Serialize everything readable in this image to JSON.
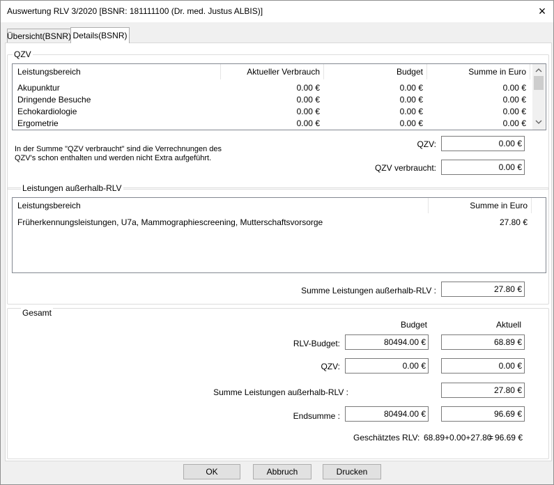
{
  "window": {
    "title": "Auswertung RLV 3/2020 [BSNR: 181111100 (Dr. med. Justus ALBIS)]",
    "close_icon": "×"
  },
  "tabs": [
    {
      "label": "Übersicht(BSNR)"
    },
    {
      "label": "Details(BSNR)"
    }
  ],
  "qzv": {
    "group_label": "QZV",
    "columns": [
      "Leistungsbereich",
      "Aktueller Verbrauch",
      "Budget",
      "Summe in Euro"
    ],
    "rows": [
      [
        "Akupunktur",
        "0.00 €",
        "0.00 €",
        "0.00 €"
      ],
      [
        "Dringende Besuche",
        "0.00 €",
        "0.00 €",
        "0.00 €"
      ],
      [
        "Echokardiologie",
        "0.00 €",
        "0.00 €",
        "0.00 €"
      ],
      [
        "Ergometrie",
        "0.00 €",
        "0.00 €",
        "0.00 €"
      ]
    ],
    "note": "In der Summe \"QZV verbraucht\" sind die Verrechnungen des QZV's schon enthalten und werden nicht Extra aufgeführt.",
    "qzv_label": "QZV:",
    "qzv_value": "0.00 €",
    "verbraucht_label": "QZV verbraucht:",
    "verbraucht_value": "0.00 €"
  },
  "ausserhalb": {
    "group_label": "Leistungen außerhalb-RLV",
    "columns": [
      "Leistungsbereich",
      "Summe in Euro"
    ],
    "rows": [
      [
        "Früherkennungsleistungen, U7a, Mammographiescreening, Mutterschaftsvorsorge",
        "27.80 €"
      ]
    ],
    "summe_label": "Summe Leistungen außerhalb-RLV :",
    "summe_value": "27.80 €"
  },
  "gesamt": {
    "group_label": "Gesamt",
    "col_budget": "Budget",
    "col_aktuell": "Aktuell",
    "rlv_label": "RLV-Budget:",
    "rlv_budget": "80494.00 €",
    "rlv_aktuell": "68.89 €",
    "qzv_label": "QZV:",
    "qzv_budget": "0.00 €",
    "qzv_aktuell": "0.00 €",
    "ausserhalb_label": "Summe Leistungen außerhalb-RLV :",
    "ausserhalb_aktuell": "27.80 €",
    "endsumme_label": "Endsumme :",
    "endsumme_budget": "80494.00 €",
    "endsumme_aktuell": "96.69 €",
    "geschaetzt_label": "Geschätztes RLV:",
    "geschaetzt_formula": "68.89+0.00+27.80",
    "geschaetzt_eq": "=",
    "geschaetzt_value": "96.69 €"
  },
  "buttons": {
    "ok": "OK",
    "abbruch": "Abbruch",
    "drucken": "Drucken"
  }
}
